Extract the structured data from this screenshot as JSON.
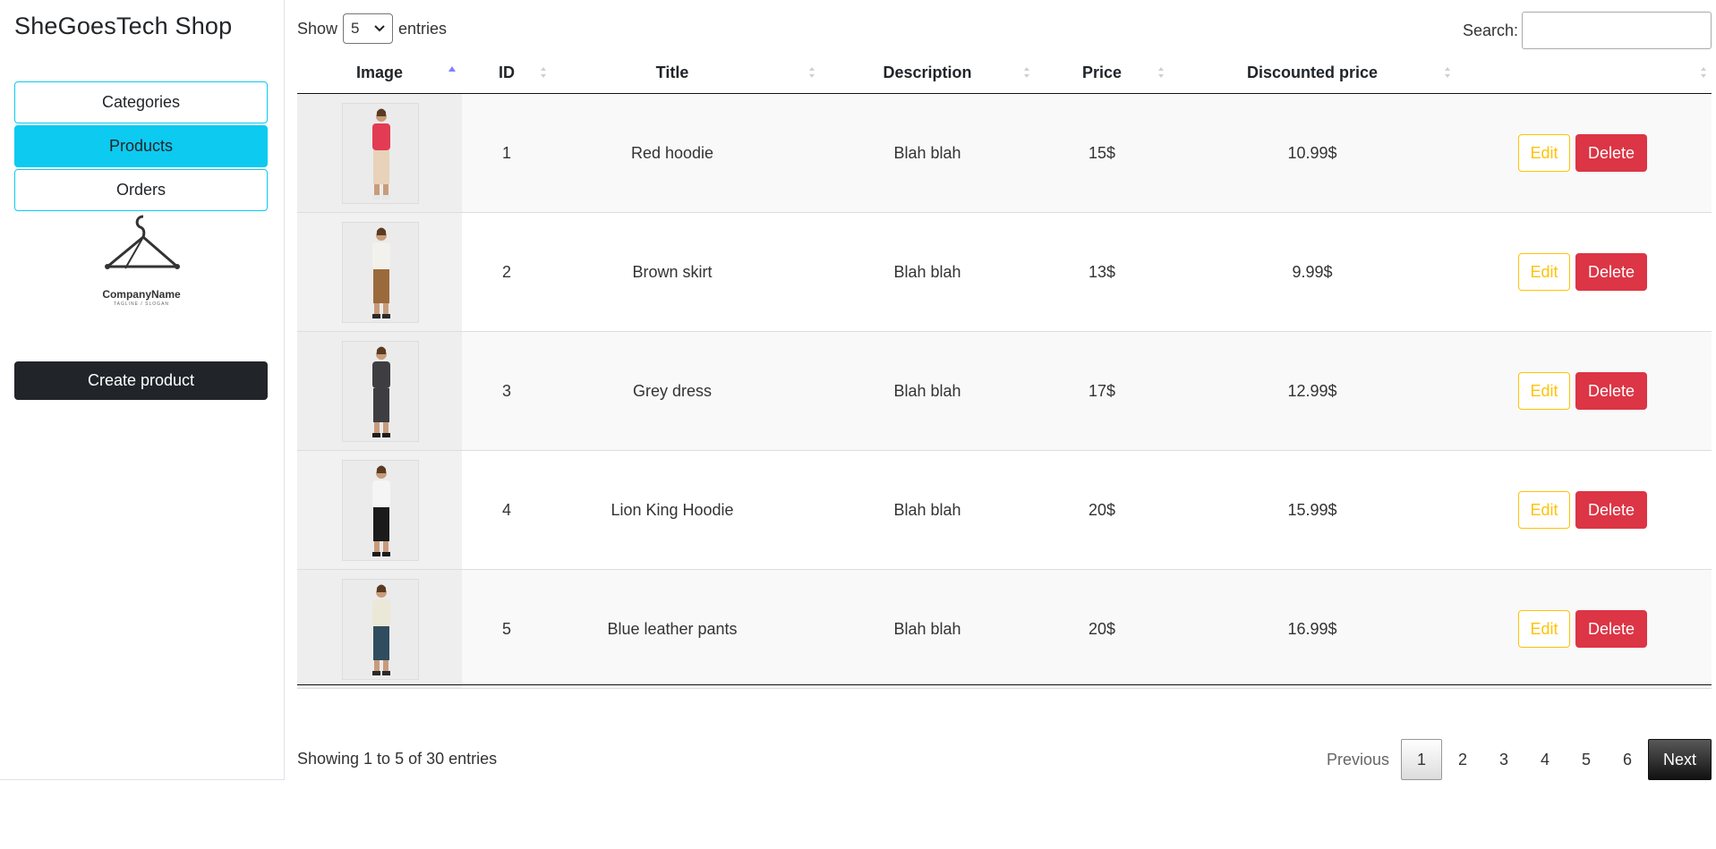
{
  "app": {
    "title": "SheGoesTech Shop"
  },
  "sidebar": {
    "items": [
      {
        "label": "Categories",
        "active": false
      },
      {
        "label": "Products",
        "active": true
      },
      {
        "label": "Orders",
        "active": false
      }
    ],
    "logo": {
      "name": "CompanyName",
      "tagline": "TAGLINE / SLOGAN",
      "icon": "hanger-icon"
    },
    "create_label": "Create product"
  },
  "length": {
    "show": "Show",
    "value": "5",
    "entries": "entries"
  },
  "search": {
    "label": "Search:",
    "value": ""
  },
  "table": {
    "headers": [
      "Image",
      "ID",
      "Title",
      "Description",
      "Price",
      "Discounted price",
      ""
    ],
    "sorted_column": "Image",
    "rows": [
      {
        "id": "1",
        "title": "Red hoodie",
        "description": "Blah blah",
        "price": "15$",
        "discounted": "10.99$",
        "edit": "Edit",
        "delete": "Delete",
        "colors": {
          "top": "#e23b53",
          "bottom": "#e8d2b9",
          "shoes": "#e6e6e6"
        }
      },
      {
        "id": "2",
        "title": "Brown skirt",
        "description": "Blah blah",
        "price": "13$",
        "discounted": "9.99$",
        "edit": "Edit",
        "delete": "Delete",
        "colors": {
          "top": "#f3f1ec",
          "bottom": "#9b6a3b",
          "shoes": "#2a2a2a"
        }
      },
      {
        "id": "3",
        "title": "Grey dress",
        "description": "Blah blah",
        "price": "17$",
        "discounted": "12.99$",
        "edit": "Edit",
        "delete": "Delete",
        "colors": {
          "top": "#3d3d42",
          "bottom": "#3d3d42",
          "shoes": "#1d1d1d"
        }
      },
      {
        "id": "4",
        "title": "Lion King Hoodie",
        "description": "Blah blah",
        "price": "20$",
        "discounted": "15.99$",
        "edit": "Edit",
        "delete": "Delete",
        "colors": {
          "top": "#f5f5f5",
          "bottom": "#1b1b1b",
          "shoes": "#1b1b1b"
        }
      },
      {
        "id": "5",
        "title": "Blue leather pants",
        "description": "Blah blah",
        "price": "20$",
        "discounted": "16.99$",
        "edit": "Edit",
        "delete": "Delete",
        "colors": {
          "top": "#ece8d8",
          "bottom": "#2f4d5e",
          "shoes": "#2a2a2a"
        }
      }
    ]
  },
  "footer": {
    "info": "Showing 1 to 5 of 30 entries",
    "previous": "Previous",
    "pages": [
      "1",
      "2",
      "3",
      "4",
      "5",
      "6"
    ],
    "current_page": "1",
    "next": "Next"
  },
  "colors": {
    "info": "#0dcaf0",
    "warning": "#ffc107",
    "danger": "#dc3545",
    "dark": "#212529",
    "sort_active": "#8080ff"
  }
}
